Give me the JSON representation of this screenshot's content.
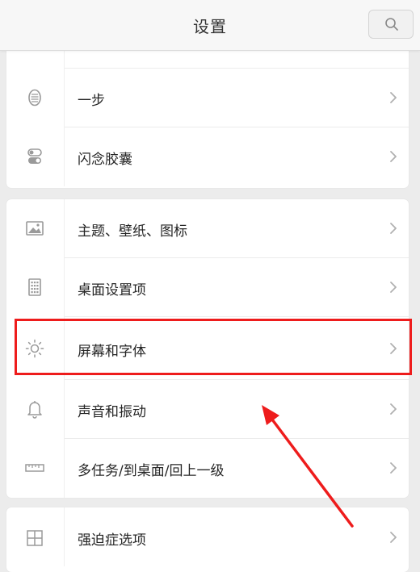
{
  "header": {
    "title": "设置"
  },
  "cards": [
    {
      "items": [
        {
          "label": "一步",
          "icon": "oval-icon"
        },
        {
          "label": "闪念胶囊",
          "icon": "capsule-icon"
        }
      ]
    },
    {
      "items": [
        {
          "label": "主题、壁纸、图标",
          "icon": "image-icon"
        },
        {
          "label": "桌面设置项",
          "icon": "grid-icon"
        },
        {
          "label": "屏幕和字体",
          "icon": "sun-icon"
        },
        {
          "label": "声音和振动",
          "icon": "bell-icon"
        },
        {
          "label": "多任务/到桌面/回上一级",
          "icon": "ruler-icon"
        }
      ]
    },
    {
      "items": [
        {
          "label": "强迫症选项",
          "icon": "squares-grid-icon"
        }
      ]
    }
  ],
  "colors": {
    "accent": "#ee1c1c",
    "background": "#ececec"
  }
}
